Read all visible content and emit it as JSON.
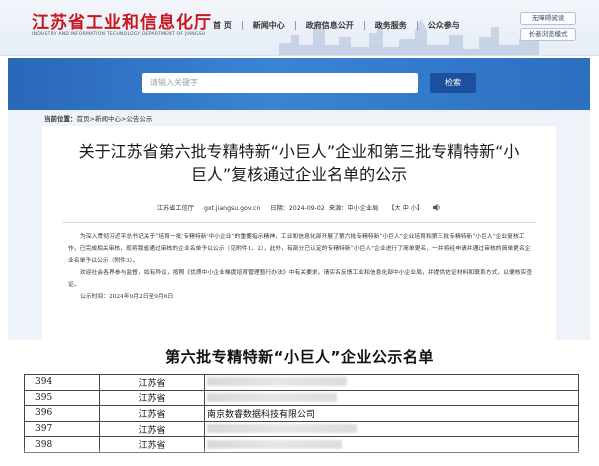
{
  "header": {
    "site_title": "江苏省工业和信息化厅",
    "site_subtitle": "INDUSTRY AND INFORMATION TECHNOLOGY DEPARTMENT OF JIANGSU",
    "nav": [
      "首 页",
      "新闻中心",
      "政府信息公开",
      "政务服务",
      "公众参与"
    ],
    "accessibility_label": "无障碍阅读",
    "elder_mode_label": "长者浏览模式"
  },
  "search": {
    "placeholder": "请输入关键字",
    "button_label": "检索"
  },
  "breadcrumb": {
    "label": "当前位置：",
    "path": "首页>新闻中心>公告公示"
  },
  "article": {
    "title_line1": "关于江苏省第六批专精特新“小巨人”企业和第三批专精特新“小",
    "title_line2": "巨人”复核通过企业名单的公示",
    "source": "江苏省工信厅",
    "domain": "gxt.jiangsu.gov.cn",
    "date": "日期：2024-09-02",
    "origin": "来源：中小企业局",
    "font_size_control": "【大 中 小】",
    "paragraphs": [
      "为深入贯彻习近平总书记关于“培育一批‘专精特新’中小企业”的重要指示精神，工业和信息化部开展了第六批专精特新“小巨人”企业培育和第三批专精特新“小巨人”企业复核工作，已完成相关审核，现将我省通过审核的企业名单予以公示（见附件1、2），此外，有部分已认定的专精特新“小巨人”企业进行了简单更名，一并将经申请并通过审核的简单更名企业名单予以公示（附件3）。",
      "欢迎社会各界参与监督，如有异议，按照《优质中小企业梯度培育管理暂行办法》中有关要求，请实名反馈工业和信息化部中小企业局，并提供佐证材料和联系方式，以便核实查证。",
      "公示时间：2024年9月2日至9月6日"
    ]
  },
  "list": {
    "title": "第六批专精特新“小巨人”企业公示名单",
    "rows": [
      {
        "no": "394",
        "province": "江苏省",
        "name": ""
      },
      {
        "no": "395",
        "province": "江苏省",
        "name": ""
      },
      {
        "no": "396",
        "province": "江苏省",
        "name": "南京数睿数据科技有限公司"
      },
      {
        "no": "397",
        "province": "江苏省",
        "name": ""
      },
      {
        "no": "398",
        "province": "江苏省",
        "name": ""
      }
    ]
  },
  "colors": {
    "brand_red": "#c8161d",
    "banner_blue": "#2d6fc0",
    "button_blue": "#1c4f9c"
  }
}
